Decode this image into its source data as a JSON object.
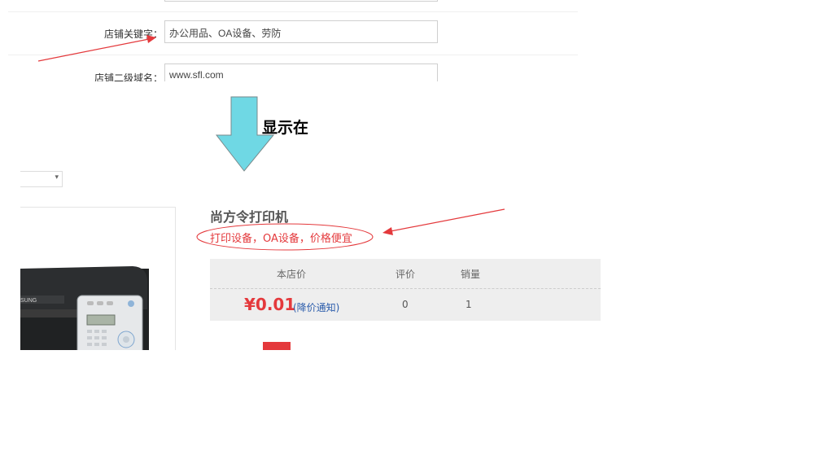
{
  "form": {
    "keyword_label": "店铺关键字：",
    "keyword_value": "办公用品、OA设备、劳防",
    "domain_label": "店铺二级域名：",
    "domain_value": "www.sfl.com"
  },
  "annotation": {
    "show_label": "显示在"
  },
  "product": {
    "title": "尚方令打印机",
    "subtitle": "打印设备，OA设备，价格便宜",
    "price_header": {
      "store_price": "本店价",
      "reviews": "评价",
      "sales": "销量"
    },
    "price": "¥0.01",
    "price_notify_link": "(降价通知)",
    "reviews_count": "0",
    "sales_count": "1"
  },
  "colors": {
    "accent_red": "#e4393c",
    "arrow_cyan": "#6fd8e4",
    "price_bg": "#eeeeee",
    "link_blue": "#2b5cab"
  }
}
